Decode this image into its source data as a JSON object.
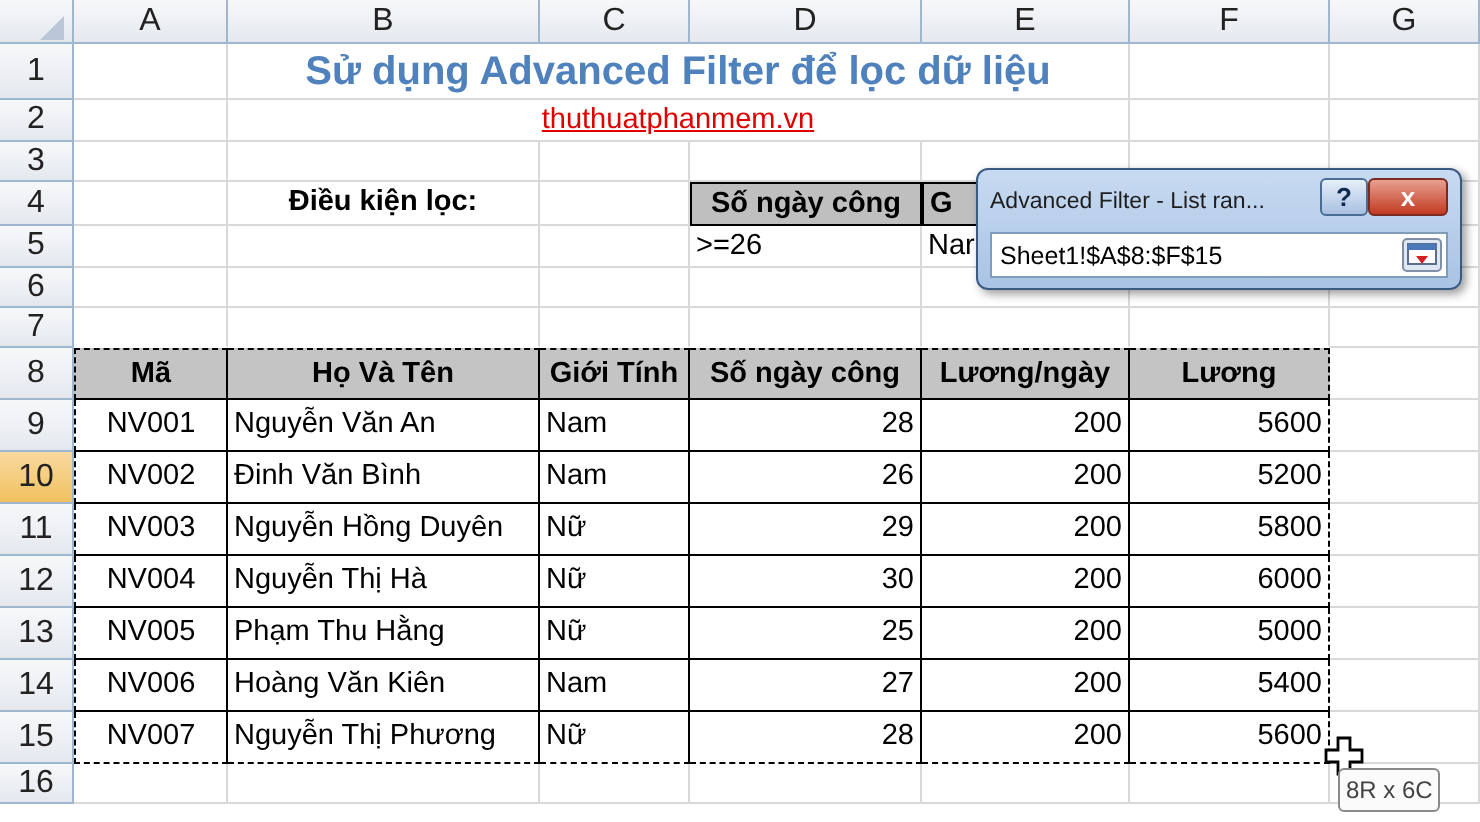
{
  "columns": [
    "A",
    "B",
    "C",
    "D",
    "E",
    "F",
    "G"
  ],
  "rows": [
    {
      "number": "1",
      "selected": false
    },
    {
      "number": "2",
      "selected": false
    },
    {
      "number": "3",
      "selected": false
    },
    {
      "number": "4",
      "selected": false
    },
    {
      "number": "5",
      "selected": false
    },
    {
      "number": "6",
      "selected": false
    },
    {
      "number": "7",
      "selected": false
    },
    {
      "number": "8",
      "selected": false
    },
    {
      "number": "9",
      "selected": false
    },
    {
      "number": "10",
      "selected": true
    },
    {
      "number": "11",
      "selected": false
    },
    {
      "number": "12",
      "selected": false
    },
    {
      "number": "13",
      "selected": false
    },
    {
      "number": "14",
      "selected": false
    },
    {
      "number": "15",
      "selected": false
    },
    {
      "number": "16",
      "selected": false
    }
  ],
  "title": "Sử dụng Advanced Filter để lọc dữ liệu",
  "link": "thuthuatphanmem.vn",
  "criteria_label": "Điều kiện lọc:",
  "criteria": {
    "headers": [
      "Số ngày công",
      "G"
    ],
    "values": [
      ">=26",
      "Nar"
    ]
  },
  "table": {
    "columns": [
      "Mã",
      "Họ Và Tên",
      "Giới Tính",
      "Số ngày công",
      "Lương/ngày",
      "Lương"
    ],
    "rows": [
      [
        "NV001",
        "Nguyễn Văn An",
        "Nam",
        "28",
        "200",
        "5600"
      ],
      [
        "NV002",
        "Đinh Văn Bình",
        "Nam",
        "26",
        "200",
        "5200"
      ],
      [
        "NV003",
        "Nguyễn Hồng Duyên",
        "Nữ",
        "29",
        "200",
        "5800"
      ],
      [
        "NV004",
        "Nguyễn Thị Hà",
        "Nữ",
        "30",
        "200",
        "6000"
      ],
      [
        "NV005",
        "Phạm Thu Hằng",
        "Nữ",
        "25",
        "200",
        "5000"
      ],
      [
        "NV006",
        "Hoàng Văn Kiên",
        "Nam",
        "27",
        "200",
        "5400"
      ],
      [
        "NV007",
        "Nguyễn Thị Phương",
        "Nữ",
        "28",
        "200",
        "5600"
      ]
    ]
  },
  "dialog": {
    "title": "Advanced Filter - List ran...",
    "help": "?",
    "close": "x",
    "value": "Sheet1!$A$8:$F$15"
  },
  "size_tip": "8R x 6C"
}
